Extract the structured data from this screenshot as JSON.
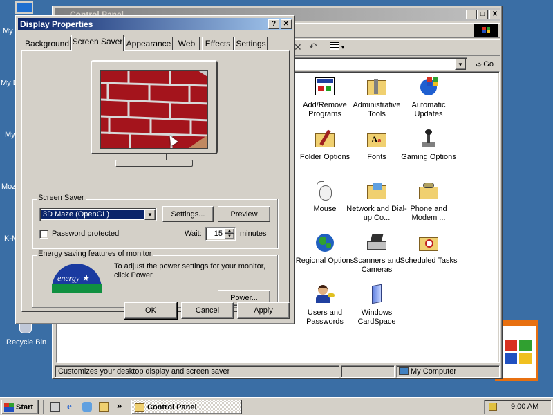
{
  "desktop": {
    "labels": [
      "My",
      "My D",
      "My",
      "Moz",
      "K-M"
    ],
    "recycle_bin": "Recycle Bin"
  },
  "control_panel": {
    "title": "Control Panel",
    "address_button": "Go",
    "status_left": "Customizes your desktop display and screen saver",
    "status_right": "My Computer",
    "items": [
      {
        "label": "Add/Remove Programs",
        "icon": "add-remove-programs-icon"
      },
      {
        "label": "Administrative Tools",
        "icon": "administrative-tools-icon"
      },
      {
        "label": "Automatic Updates",
        "icon": "automatic-updates-icon"
      },
      {
        "label": "Folder Options",
        "icon": "folder-options-icon"
      },
      {
        "label": "Fonts",
        "icon": "fonts-icon"
      },
      {
        "label": "Gaming Options",
        "icon": "gaming-options-icon"
      },
      {
        "label": "Mouse",
        "icon": "mouse-icon"
      },
      {
        "label": "Network and Dial-up Co...",
        "icon": "network-icon"
      },
      {
        "label": "Phone and Modem ...",
        "icon": "phone-modem-icon"
      },
      {
        "label": "Regional Options",
        "icon": "regional-options-icon"
      },
      {
        "label": "Scanners and Cameras",
        "icon": "scanners-cameras-icon"
      },
      {
        "label": "Scheduled Tasks",
        "icon": "scheduled-tasks-icon"
      },
      {
        "label": "Users and Passwords",
        "icon": "users-passwords-icon"
      },
      {
        "label": "Windows CardSpace",
        "icon": "cardspace-icon"
      }
    ]
  },
  "display_properties": {
    "title": "Display Properties",
    "help_btn": "?",
    "close_btn": "✕",
    "tabs": [
      "Background",
      "Screen Saver",
      "Appearance",
      "Web",
      "Effects",
      "Settings"
    ],
    "active_tab": "Screen Saver",
    "screen_saver_group": "Screen Saver",
    "screen_saver_selected": "3D Maze (OpenGL)",
    "settings_btn": "Settings...",
    "preview_btn": "Preview",
    "password_label": "Password protected",
    "password_checked": false,
    "wait_label": "Wait:",
    "wait_value": "15",
    "wait_unit": "minutes",
    "energy_group": "Energy saving features of monitor",
    "energy_text": "To adjust the power settings for your monitor, click Power.",
    "power_btn": "Power...",
    "ok_btn": "OK",
    "cancel_btn": "Cancel",
    "apply_btn": "Apply"
  },
  "taskbar": {
    "start_label": "Start",
    "task_label": "Control Panel",
    "chevron": "»",
    "clock": "9:00 AM"
  },
  "colors": {
    "desktop": "#3a6ea5",
    "active_title": "#0a246a",
    "inactive_title": "#808080",
    "selection": "#0a246a",
    "brick": "#a4141c"
  }
}
